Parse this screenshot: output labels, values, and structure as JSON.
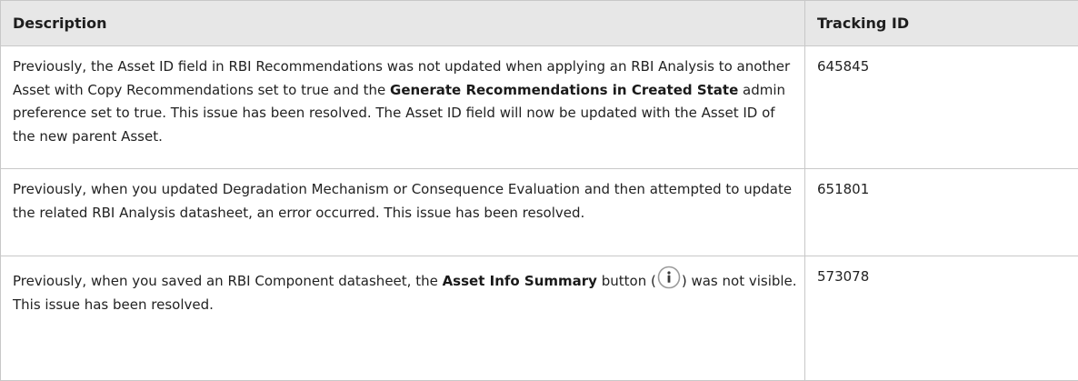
{
  "table": {
    "headers": {
      "description": "Description",
      "tracking_id": "Tracking ID"
    },
    "rows": [
      {
        "desc_a": "Previously, the Asset ID field in RBI Recommendations was not updated when applying an RBI Analysis to another Asset with Copy Recommendations set to true and the ",
        "desc_bold": "Generate Recommendations in Created State",
        "desc_b": " admin preference set to true. This issue has been resolved. The Asset ID field will now be updated with the Asset ID of the new parent Asset.",
        "tracking_id": "645845"
      },
      {
        "desc": "Previously, when you updated Degradation Mechanism or Consequence Evaluation and then attempted to update the related RBI Analysis datasheet, an error occurred. This issue has been resolved.",
        "tracking_id": "651801"
      },
      {
        "desc_a": "Previously, when you saved an RBI Component datasheet, the ",
        "desc_bold": "Asset Info Summary",
        "desc_b": " button (",
        "icon": "info-circle-icon",
        "desc_c": ") was not visible. This issue has been resolved.",
        "tracking_id": "573078"
      }
    ]
  }
}
